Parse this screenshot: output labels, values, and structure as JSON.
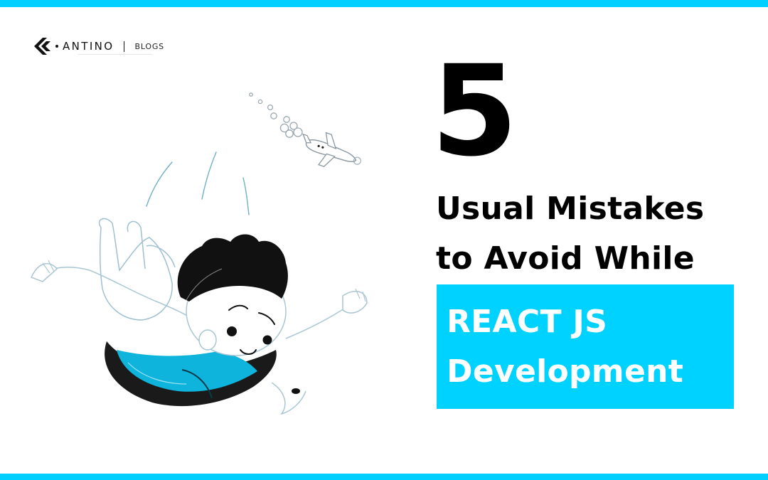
{
  "brand": {
    "logo_icon": "antino-k-icon",
    "name": "ANTINO",
    "tag": "BLOGS"
  },
  "headline": {
    "number": "5",
    "line1": "Usual Mistakes",
    "line2": "to Avoid While",
    "highlight_line1": "REACT JS",
    "highlight_line2": "Development"
  },
  "colors": {
    "accent": "#00d2ff",
    "text": "#000000",
    "highlight_text": "#ffffff"
  },
  "illustration": {
    "subject": "skydiving-character-illustration",
    "icons": [
      "airplane-icon",
      "cloud-trail-icon"
    ]
  }
}
